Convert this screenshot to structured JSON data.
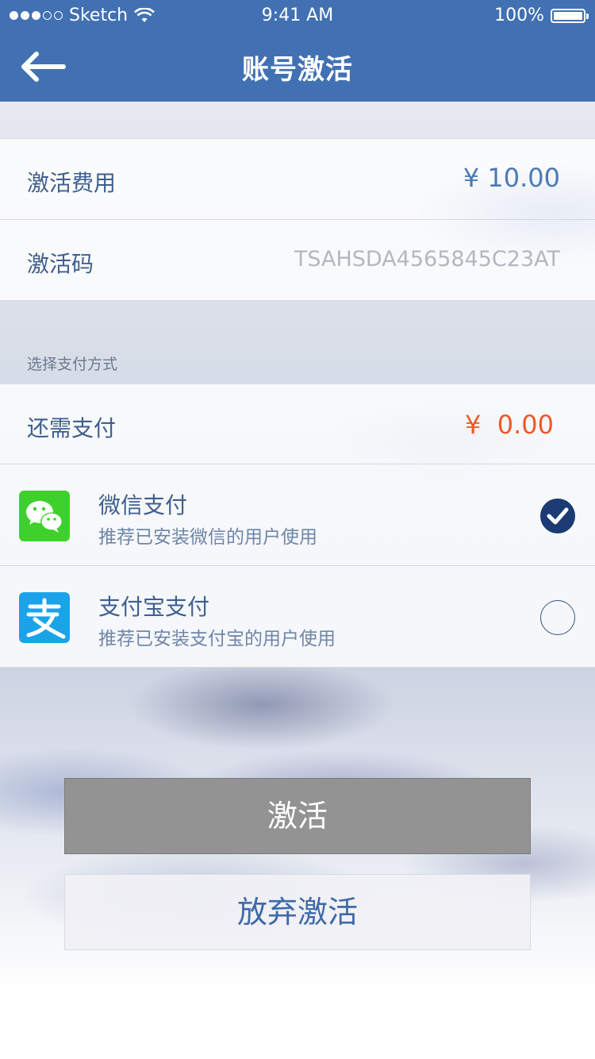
{
  "status_bar": {
    "carrier": "Sketch",
    "time": "9:41 AM",
    "battery": "100%",
    "signal_bars_filled": 3,
    "signal_bars_total": 5
  },
  "nav": {
    "title": "账号激活",
    "back_icon": "arrow-left-icon"
  },
  "fee": {
    "label": "激活费用",
    "value": "¥ 10.00"
  },
  "code": {
    "label": "激活码",
    "value": "TSAHSDA4565845C23AT"
  },
  "payment": {
    "section_label": "选择支付方式",
    "remaining_label": "还需支付",
    "remaining_value": "¥  0.00",
    "methods": [
      {
        "title": "微信支付",
        "description": "推荐已安装微信的用户使用",
        "icon": "wechat-icon",
        "selected": true
      },
      {
        "title": "支付宝支付",
        "description": "推荐已安装支付宝的用户使用",
        "icon": "alipay-icon",
        "selected": false
      }
    ]
  },
  "buttons": {
    "activate": "激活",
    "abandon": "放弃激活"
  },
  "colors": {
    "header": "#4171b3",
    "accent_text": "#4d79b4",
    "remaining_value": "#ec5a2a",
    "wechat": "#3fd12b",
    "alipay": "#1aa3e8",
    "check": "#1c3a73",
    "activate_button": "#939393"
  }
}
